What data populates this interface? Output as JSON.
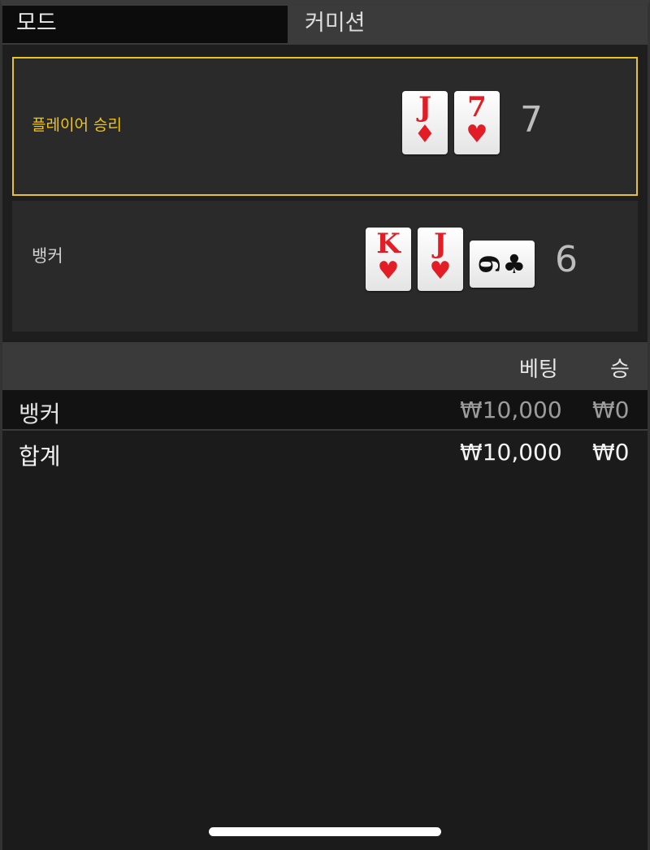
{
  "mode": {
    "label": "모드",
    "value": "커미션"
  },
  "result": {
    "player": {
      "label": "플레이어 승리",
      "score": "7",
      "cards": [
        {
          "rank": "J",
          "suit": "♦",
          "color": "#e21d25"
        },
        {
          "rank": "7",
          "suit": "♥",
          "color": "#e21d25"
        }
      ]
    },
    "banker": {
      "label": "뱅커",
      "score": "6",
      "cards": [
        {
          "rank": "K",
          "suit": "♥",
          "color": "#e21d25"
        },
        {
          "rank": "J",
          "suit": "♥",
          "color": "#e21d25"
        },
        {
          "rank": "6",
          "suit": "♣",
          "color": "#111111"
        }
      ]
    }
  },
  "bets": {
    "headers": {
      "bet": "베팅",
      "win": "승"
    },
    "rows": [
      {
        "name": "뱅커",
        "bet": "₩10,000",
        "win": "₩0"
      }
    ],
    "total": {
      "name": "합계",
      "bet": "₩10,000",
      "win": "₩0"
    }
  },
  "colors": {
    "winner_accent": "#e6c22b",
    "card_red": "#e21d25"
  }
}
